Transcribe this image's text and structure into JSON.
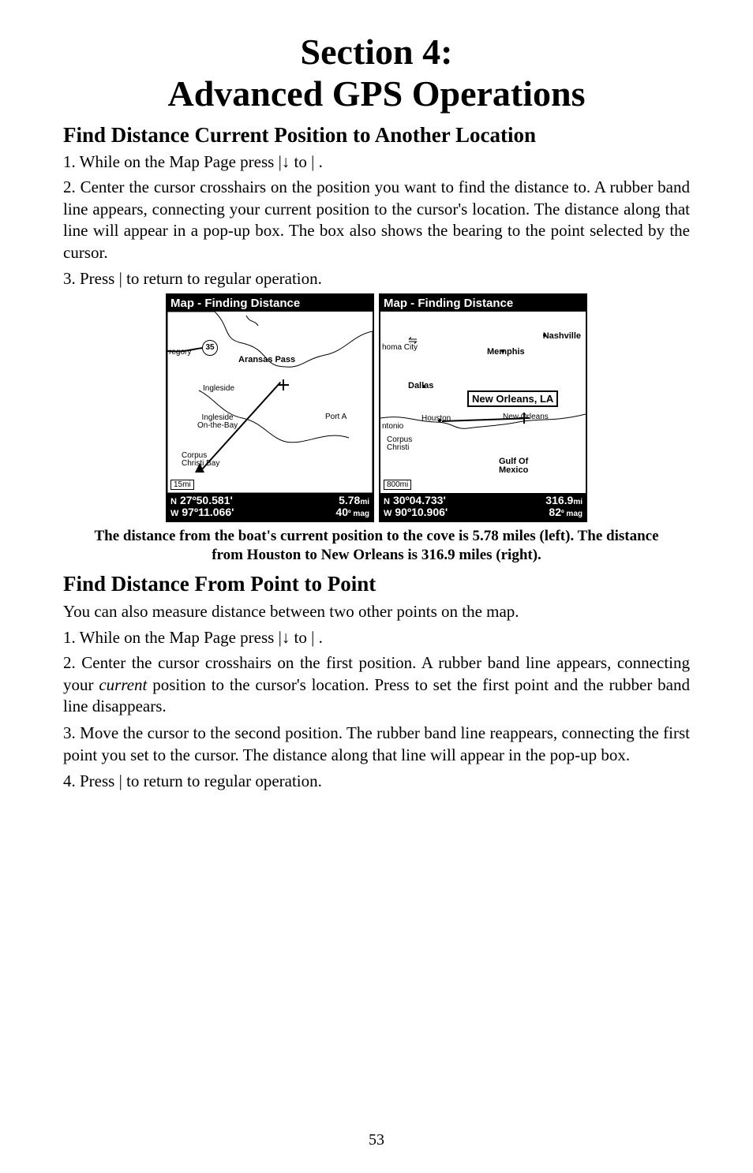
{
  "section_heading_line1": "Section 4:",
  "section_heading_line2": "Advanced GPS Operations",
  "sub1": "Find Distance Current Position to Another Location",
  "s1_step1_a": "1. While on the Map Page press ",
  "s1_step1_b": "|↓ to ",
  "s1_step1_c": "|",
  "s1_step1_d": ".",
  "s1_step2": "2. Center the cursor crosshairs on the position you want to find the distance to. A rubber band line appears, connecting your current position to the cursor's location. The distance along that line will appear in a pop-up box. The box also shows the bearing to the point selected by the cursor.",
  "s1_step3_a": "3. Press ",
  "s1_step3_b": "|",
  "s1_step3_c": " to return to regular operation.",
  "fig_left": {
    "title": "Map - Finding Distance",
    "scale": "15mi",
    "labels": {
      "regory": "regory",
      "aransas": "Aransas Pass",
      "ingleside": "Ingleside",
      "ingleside2": "Ingleside\nOn-the-Bay",
      "corpus": "Corpus\nChristi Bay",
      "porta": "Port A",
      "route": "35"
    },
    "footer_lat": "27º50.581'",
    "footer_lon": "97º11.066'",
    "footer_dist": "5.78",
    "footer_dist_unit": "mi",
    "footer_bearing": "40",
    "footer_bearing_unit": "º mag"
  },
  "fig_right": {
    "title": "Map - Finding Distance",
    "scale": "800mi",
    "labels": {
      "nashville": "Nashville",
      "memphis": "Memphis",
      "homa": "homa City",
      "dallas": "Dallas",
      "houston": "Houston",
      "ntonio": "ntonio",
      "neworleans": "New Orleans",
      "corpus": "Corpus\nChristi",
      "gulf": "Gulf Of\nMexico"
    },
    "popup": "New Orleans, LA",
    "footer_lat": "30º04.733'",
    "footer_lon": "90º10.906'",
    "footer_dist": "316.9",
    "footer_dist_unit": "mi",
    "footer_bearing": "82",
    "footer_bearing_unit": "º mag"
  },
  "caption": "The distance from the boat's current position to the cove is 5.78 miles (left). The distance from Houston to New Orleans is 316.9 miles (right).",
  "sub2": "Find Distance From Point to Point",
  "s2_intro": "You can also measure distance between two other points on the map.",
  "s2_step1_a": "1. While on the Map Page press ",
  "s2_step1_b": "|↓ to ",
  "s2_step1_c": "|",
  "s2_step1_d": ".",
  "s2_step2_a": "2. Center the cursor crosshairs on the first position. A rubber band line appears, connecting your ",
  "s2_step2_em": "current",
  "s2_step2_b": " position to the cursor's location. Press ",
  "s2_step2_c": " to set the first point and the rubber band line disappears.",
  "s2_step3": "3. Move the cursor to the second position. The rubber band line reappears, connecting the first point you set to the cursor. The distance along that line will appear in the pop-up box.",
  "s2_step4_a": "4. Press ",
  "s2_step4_b": "|",
  "s2_step4_c": " to return to regular operation.",
  "page_number": "53"
}
